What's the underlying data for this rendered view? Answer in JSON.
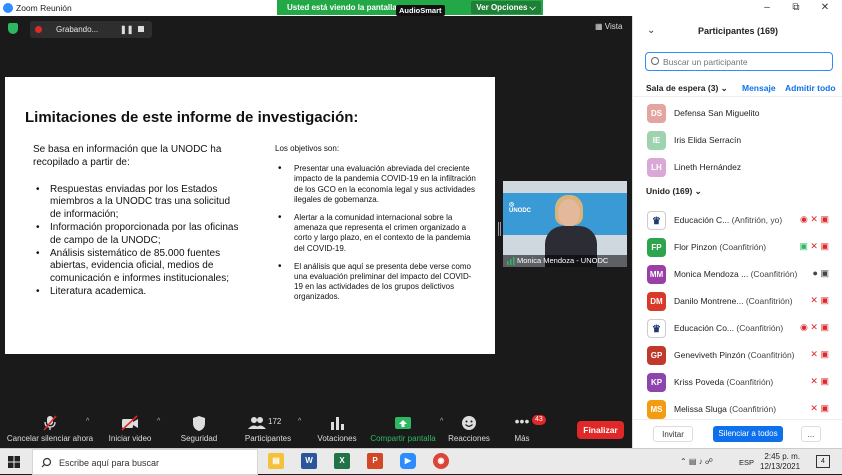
{
  "window": {
    "title": "Zoom Reunión"
  },
  "banner": {
    "viewing": "Usted está viendo la pantalla",
    "ver_opciones": "Ver Opciones",
    "overlay": "AudioSmart"
  },
  "recording": {
    "label": "Grabando..."
  },
  "view_button": "Vista",
  "slide": {
    "title": "Limitaciones de este informe de investigación:",
    "intro": "Se basa en información que la UNODC ha recopilado a partir de:",
    "left_items": [
      "Respuestas enviadas por los Estados miembros a la UNODC tras una solicitud de información;",
      "Información proporcionada por las oficinas de campo de la UNODC;",
      "Análisis sistemático de 85.000 fuentes abiertas, evidencia oficial, medios de comunicación e informes institucionales;",
      "Literatura academica."
    ],
    "right_heading": "Los objetivos son:",
    "right_items": [
      "Presentar una evaluación abreviada del creciente impacto de la pandemia COVID-19 en la infiltración de los GCO en la economía legal y sus actividades ilegales de gobernanza.",
      "Alertar a la comunidad internacional sobre la amenaza que representa el crimen organizado a corto y largo plazo, en el contexto de la pandemia del COVID-19.",
      "El análisis que aquí se presenta debe verse como una evaluación preliminar del impacto del COVID-19 en las actividades de los grupos delictivos organizados."
    ]
  },
  "speaker": {
    "name": "Monica Mendoza - UNODC",
    "logo": "UNODC"
  },
  "toolbar": {
    "mute": "Cancelar silenciar ahora",
    "video": "Iniciar video",
    "security": "Seguridad",
    "participants": "Participantes",
    "participants_count": "172",
    "polls": "Votaciones",
    "share": "Compartir pantalla",
    "reactions": "Reacciones",
    "more": "Más",
    "more_badge": "43",
    "end": "Finalizar"
  },
  "panel": {
    "title": "Participantes (169)",
    "search_placeholder": "Buscar un participante",
    "waiting_label": "Sala de espera (3)",
    "message": "Mensaje",
    "admit": "Admitir todo",
    "waiting": [
      {
        "initials": "DS",
        "name": "Defensa San Miguelito",
        "color": "#e3a5a0"
      },
      {
        "initials": "IE",
        "name": "Iris Elida Serracín",
        "color": "#9fd3b0"
      },
      {
        "initials": "LH",
        "name": "Lineth Hernández",
        "color": "#d9a8d6"
      }
    ],
    "joined_label": "Unido (169)",
    "joined": [
      {
        "initials": "",
        "name": "Educación C...",
        "role": "(Anfitrión, yo)",
        "color": "#ffffff",
        "logo": true
      },
      {
        "initials": "FP",
        "name": "Flor Pinzon",
        "role": "(Coanfitrión)",
        "color": "#2ea44f"
      },
      {
        "initials": "MM",
        "name": "Monica Mendoza ...",
        "role": "(Coanfitrión)",
        "color": "#9b3fa8"
      },
      {
        "initials": "DM",
        "name": "Danilo Montrene...",
        "role": "(Coanfitrión)",
        "color": "#d8392b"
      },
      {
        "initials": "",
        "name": "Educación Co...",
        "role": "(Coanfitrión)",
        "color": "#ffffff",
        "logo": true
      },
      {
        "initials": "GP",
        "name": "Geneviveth Pinzón",
        "role": "(Coanfitrión)",
        "color": "#c0392b"
      },
      {
        "initials": "KP",
        "name": "Kriss Poveda",
        "role": "(Coanfitrión)",
        "color": "#8e44ad"
      },
      {
        "initials": "MS",
        "name": "Melissa Sluga",
        "role": "(Coanfitrión)",
        "color": "#f39c12"
      }
    ],
    "invite": "Invitar",
    "mute_all": "Silenciar a todos",
    "more": "..."
  },
  "taskbar": {
    "search": "Escribe aquí para buscar",
    "lang": "ESP",
    "time": "2:45 p. m.",
    "date": "12/13/2021",
    "notif": "4"
  }
}
